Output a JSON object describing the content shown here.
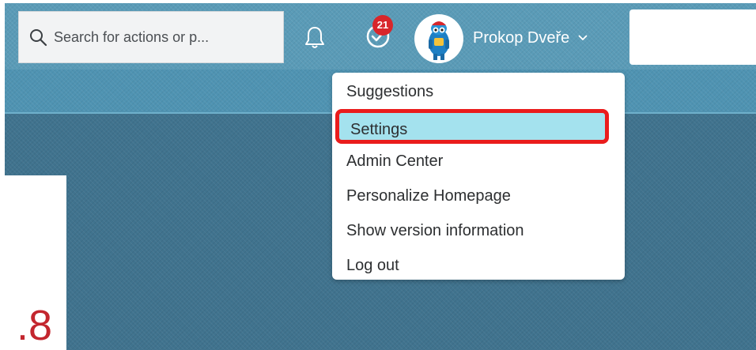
{
  "header": {
    "search": {
      "placeholder": "Search for actions or p..."
    },
    "notifications_icon": "bell-icon",
    "tasks": {
      "icon": "check-circle-icon",
      "badge_count": "21",
      "badge_color": "#d8262b"
    },
    "user": {
      "name": "Prokop Dveře",
      "avatar_icon": "robot-avatar"
    }
  },
  "user_menu": {
    "items": [
      {
        "label": "Suggestions"
      },
      {
        "label": "Settings",
        "selected": true
      },
      {
        "label": "Admin Center"
      },
      {
        "label": "Personalize Homepage"
      },
      {
        "label": "Show version information"
      },
      {
        "label": "Log out"
      }
    ]
  },
  "content": {
    "partial_value": ".8"
  },
  "colors": {
    "header_bg": "#5a9bb7",
    "content_bg": "#40738e",
    "highlight_fill": "#a4e2ee",
    "highlight_border": "#ea1c1c",
    "value_text": "#c3262e"
  }
}
